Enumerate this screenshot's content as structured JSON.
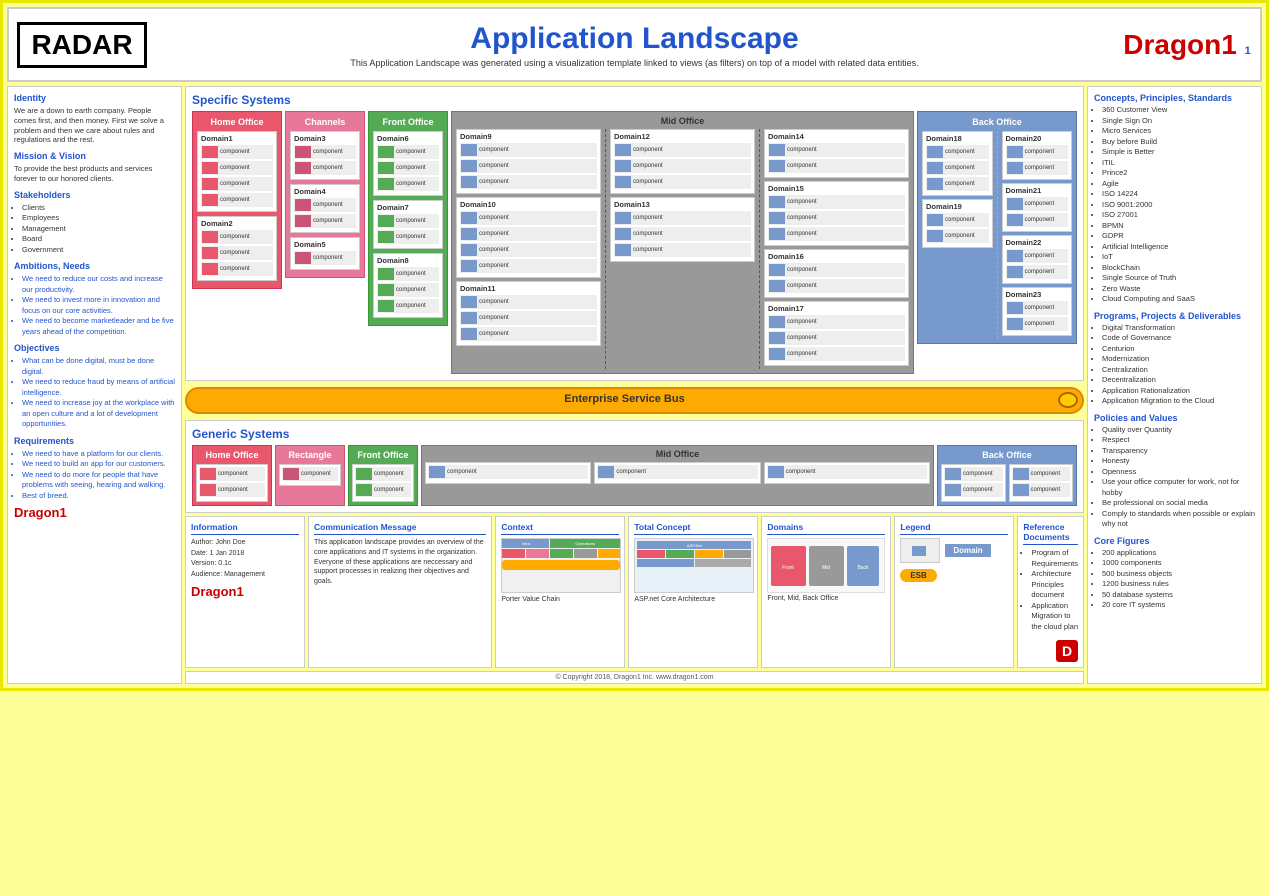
{
  "header": {
    "radar_label": "RADAR",
    "title": "Application Landscape",
    "subtitle": "This Application Landscape was generated using a visualization template linked to views (as filters) on top of a model with related data entities.",
    "dragon1_label": "Dragon1"
  },
  "left_sidebar": {
    "identity_title": "Identity",
    "identity_text": "We are a down to earth company. People comes first, and then money. First we solve a problem and then we care about rules and regulations and the rest.",
    "mission_title": "Mission & Vision",
    "mission_text": "To provide the best products and services forever to our honored clients.",
    "stakeholders_title": "Stakeholders",
    "stakeholders": [
      "Clients",
      "Employees",
      "Management",
      "Board",
      "Government"
    ],
    "ambitions_title": "Ambitions, Needs",
    "ambitions": [
      "We need to reduce our costs and increase our productivity.",
      "We need to invest more in innovation and focus on our core activities.",
      "We need to become marketleader and be five years ahead of the competition."
    ],
    "objectives_title": "Objectives",
    "objectives": [
      "What can be done digital, must be done digital.",
      "We need to reduce fraud by means of artificial intelligence.",
      "We need to increase joy at the workplace with an open culture and a lot of development opportunities."
    ],
    "requirements_title": "Requirements",
    "requirements": [
      "We need to have a platform for our clients.",
      "We need to build an app for our customers.",
      "We need to do more for people that have problems with seeing, hearing and walking.",
      "Best of breed."
    ],
    "dragon1_logo": "Dragon1"
  },
  "specific_systems": {
    "title": "Specific Systems",
    "home_office_label": "Home Office",
    "channels_label": "Channels",
    "front_office_label": "Front Office",
    "mid_office_label": "Mid Office",
    "back_office_label": "Back Office",
    "domains": {
      "domain1": "Domain1",
      "domain2": "Domain2",
      "domain3": "Domain3",
      "domain4": "Domain4",
      "domain5": "Domain5",
      "domain6": "Domain6",
      "domain7": "Domain7",
      "domain8": "Domain8",
      "domain9": "Domain9",
      "domain10": "Domain10",
      "domain11": "Domain11",
      "domain12": "Domain12",
      "domain13": "Domain13",
      "domain14": "Domain14",
      "domain15": "Domain15",
      "domain16": "Domain16",
      "domain17": "Domain17",
      "domain18": "Domain18",
      "domain19": "Domain19",
      "domain20": "Domain20",
      "domain21": "Domain21",
      "domain22": "Domain22",
      "domain23": "Domain23"
    },
    "component_label": "component"
  },
  "esb": {
    "label": "Enterprise Service Bus"
  },
  "generic_systems": {
    "title": "Generic Systems",
    "home_office_label": "Home Office",
    "rectangle_label": "Rectangle",
    "front_office_label": "Front Office",
    "mid_office_label": "Mid Office",
    "back_office_label": "Back Office",
    "component_label": "component"
  },
  "bottom": {
    "information_title": "Information",
    "information_text": "Author: John Doe\nDate: 1 Jan 2018\nVersion: 0.1c\nAudience: Management",
    "dragon1_logo": "Dragon1",
    "communication_title": "Communication Message",
    "communication_text": "This application landscape provides an overview of the core applications and IT systems in the organization. Everyone of these applications are neccessary and support processes in realizing their objectives and goals.",
    "context_title": "Context",
    "pvc_label": "Porter Value Chain",
    "total_concept_title": "Total Concept",
    "aspnet_label": "ASP.net Core Architecture",
    "domains_title": "Domains",
    "domains_label": "Front, Mid, Back Office",
    "legend_title": "Legend",
    "domain_label": "Domain",
    "esb_label": "ESB",
    "reference_title": "Reference Documents",
    "references": [
      "Program of Requirements",
      "Architecture Principles document",
      "Application Migration to the cloud plan"
    ],
    "dragon1_icon": "D"
  },
  "right_sidebar": {
    "concepts_title": "Concepts, Principles, Standards",
    "concepts": [
      "360 Customer View",
      "Single Sign On",
      "Micro Services",
      "Buy before Build",
      "Simple is Better",
      "ITIL",
      "Prince2",
      "Agile",
      "ISO 14224",
      "ISO 9001:2000",
      "ISO 27001",
      "BPMN",
      "GDPR",
      "Artificial Intelligence",
      "IoT",
      "BlockChain",
      "Single Source of Truth",
      "Zero Waste",
      "Cloud Computing and SaaS"
    ],
    "programs_title": "Programs, Projects & Deliverables",
    "programs": [
      "Digital Transformation",
      "Code of Governance",
      "Centurion",
      "Modernization",
      "Centralization",
      "Decentralization",
      "Application Rationalization",
      "Application Migration to the Cloud"
    ],
    "policies_title": "Policies and Values",
    "policies": [
      "Quality over Quantity",
      "Respect",
      "Transparency",
      "Honesty",
      "Openness",
      "Use your office computer for work, not for hobby",
      "Be professional on social media",
      "Comply to standards when possible or explain why not"
    ],
    "core_title": "Core Figures",
    "core_figures": [
      "200 applications",
      "1000 components",
      "500 business objects",
      "1200 business rules",
      "50 database systems",
      "20 core IT systems"
    ]
  },
  "footer": {
    "copyright": "© Copyright 2018, Dragon1 Inc. www.dragon1.com"
  }
}
